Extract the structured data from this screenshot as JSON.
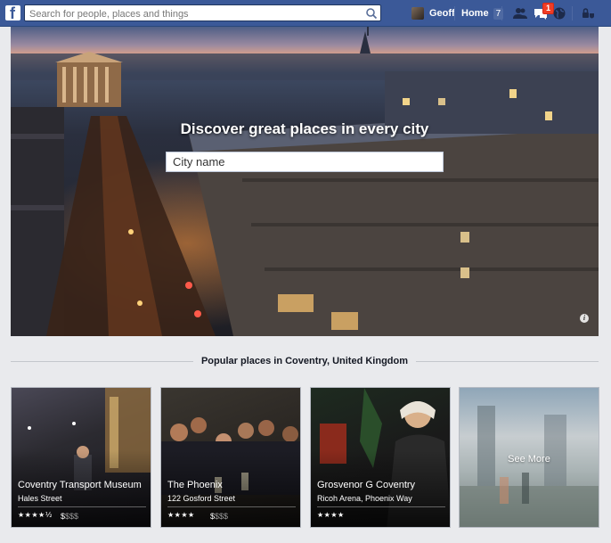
{
  "topbar": {
    "logo_letter": "f",
    "search_placeholder": "Search for people, places and things",
    "user_name": "Geoff",
    "home_label": "Home",
    "home_count": "7",
    "notification_count": "1",
    "colors": {
      "bar": "#3b5998",
      "badge": "#f03d25"
    }
  },
  "hero": {
    "title": "Discover great places in every city",
    "city_placeholder": "City name",
    "info_glyph": "i"
  },
  "section": {
    "title": "Popular places in Coventry, United Kingdom"
  },
  "cards": [
    {
      "name": "Coventry Transport Museum",
      "address": "Hales Street",
      "rating": "★★★★½",
      "price_active": "$",
      "price_dim": "$$$"
    },
    {
      "name": "The Phoenix",
      "address": "122 Gosford Street",
      "rating": "★★★★",
      "price_active": "$",
      "price_dim": "$$$"
    },
    {
      "name": "Grosvenor G Coventry",
      "address": "Ricoh Arena, Phoenix Way",
      "rating": "★★★★",
      "price_active": "",
      "price_dim": ""
    },
    {
      "see_more": "See More"
    }
  ]
}
